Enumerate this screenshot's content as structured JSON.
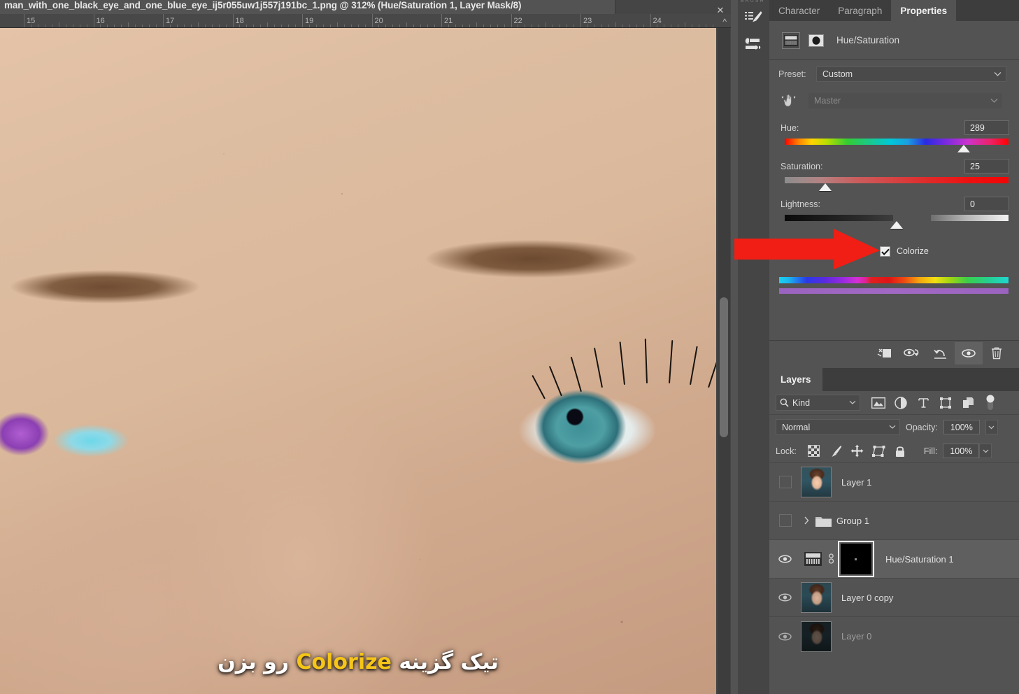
{
  "document": {
    "tab_title": "man_with_one_black_eye_and_one_blue_eye_ij5r055uw1j557j191bc_1.png @ 312% (Hue/Saturation 1, Layer Mask/8)",
    "close_icon": "close-icon",
    "collapse_icon": "chevron-up-icon",
    "zoom_level": "312%",
    "ruler_ticks": [
      "15",
      "16",
      "17",
      "18",
      "19",
      "20",
      "21",
      "22",
      "23",
      "24"
    ]
  },
  "subtitle": {
    "before": "تیک گزینه ",
    "highlight": "Colorize",
    "after": " رو بزن",
    "highlight_color": "#f5c518"
  },
  "icon_rail": {
    "label": "BRUSH",
    "items": [
      {
        "name": "brush-presets-icon"
      },
      {
        "name": "brush-settings-icon"
      }
    ]
  },
  "panel_tabs": [
    {
      "label": "Character",
      "active": false
    },
    {
      "label": "Paragraph",
      "active": false
    },
    {
      "label": "Properties",
      "active": true
    }
  ],
  "properties": {
    "title": "Hue/Saturation",
    "adjustment_icon": "hue-saturation-icon",
    "mask_icon": "layer-mask-icon",
    "preset": {
      "label": "Preset:",
      "value": "Custom",
      "chevron": "chevron-down-icon"
    },
    "channel": {
      "value": "Master",
      "chevron": "chevron-down-icon",
      "hand_icon": "on-image-adjust-icon"
    },
    "sliders": [
      {
        "label": "Hue:",
        "value": "289",
        "thumb_pct": 80
      },
      {
        "label": "Saturation:",
        "value": "25",
        "thumb_pct": 18
      },
      {
        "label": "Lightness:",
        "value": "0",
        "thumb_pct": 50
      }
    ],
    "colorize": {
      "label": "Colorize",
      "checked": true
    },
    "eyedroppers": [
      "eyedropper-icon",
      "eyedropper-plus-icon",
      "eyedropper-minus-icon"
    ],
    "footer_buttons": [
      {
        "name": "clip-to-layer-icon",
        "selected": false
      },
      {
        "name": "toggle-previous-state-icon",
        "selected": false
      },
      {
        "name": "reset-adjustment-icon",
        "selected": false
      },
      {
        "name": "toggle-visibility-icon",
        "selected": true
      },
      {
        "name": "delete-adjustment-icon",
        "selected": false
      }
    ]
  },
  "layers_panel": {
    "tab_label": "Layers",
    "filter": {
      "search_icon": "search-icon",
      "kind_label": "Kind",
      "chevron": "chevron-down-icon",
      "icons": [
        "pixel-filter-icon",
        "adjustment-filter-icon",
        "type-filter-icon",
        "shape-filter-icon",
        "smart-object-filter-icon"
      ],
      "toggle": "filter-toggle-switch"
    },
    "blend": {
      "mode": "Normal",
      "opacity_label": "Opacity:",
      "opacity_value": "100%"
    },
    "lock": {
      "label": "Lock:",
      "icons": [
        "lock-transparency-icon",
        "lock-image-icon",
        "lock-position-icon",
        "lock-artboard-icon",
        "lock-all-icon"
      ],
      "fill_label": "Fill:",
      "fill_value": "100%"
    },
    "layers": [
      {
        "name": "Layer 1",
        "visible": false,
        "selected": false,
        "type": "image",
        "thumb": "portrait-bright"
      },
      {
        "name": "Group 1",
        "visible": false,
        "selected": false,
        "type": "group",
        "expand_icon": "chevron-right-icon",
        "folder_icon": "folder-icon"
      },
      {
        "name": "Hue/Saturation 1",
        "visible": true,
        "selected": true,
        "type": "adjustment",
        "adjustment_icon": "hue-saturation-icon",
        "link_icon": "link-mask-icon",
        "mask": "black-mask"
      },
      {
        "name": "Layer 0 copy",
        "visible": true,
        "selected": false,
        "type": "image",
        "thumb": "portrait-dark"
      },
      {
        "name": "Layer 0",
        "visible": true,
        "selected": false,
        "type": "image",
        "thumb": "portrait-darker",
        "dim": true
      }
    ]
  },
  "annotation": {
    "arrow": "red-arrow-pointing-right",
    "color": "#f01e14",
    "points_to": "Colorize"
  },
  "colors": {
    "panel_bg": "#535353",
    "panel_dark": "#3d3d3d",
    "field_bg": "#4a4a4a",
    "text": "#e0e0e0",
    "selected_row": "#5f5f5f",
    "accent_red": "#f01e14",
    "subtitle_highlight": "#f5c518"
  }
}
